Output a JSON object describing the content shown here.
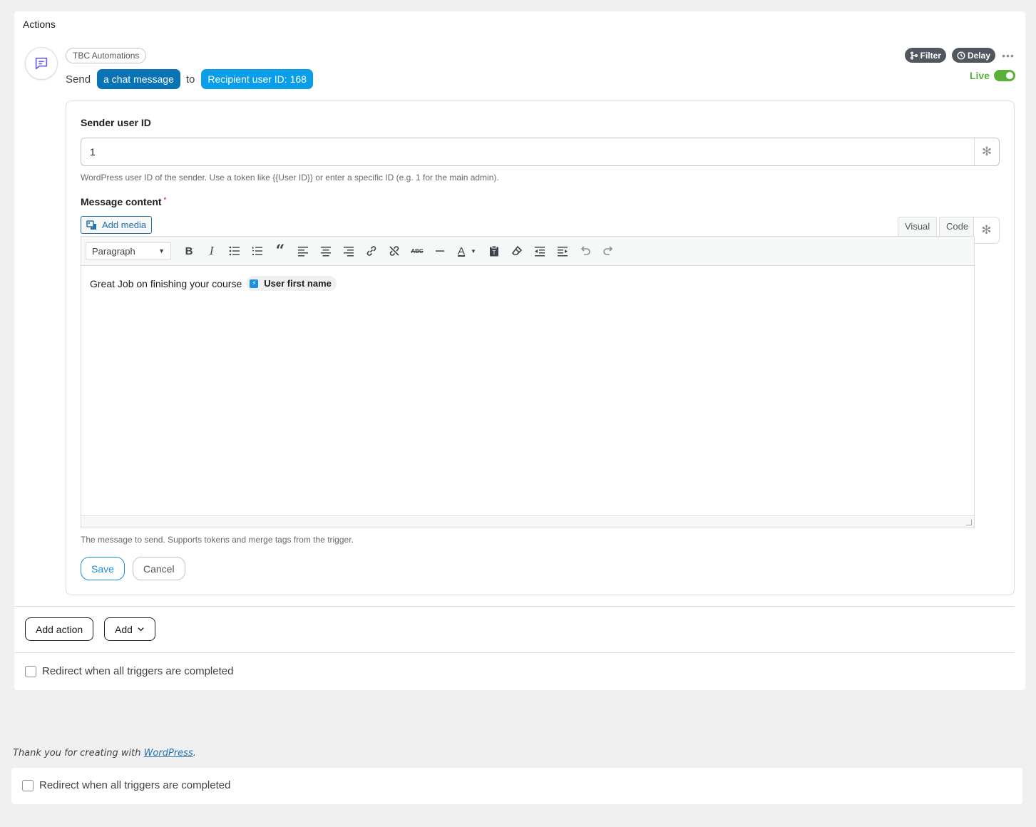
{
  "panel": {
    "title": "Actions"
  },
  "action": {
    "integration": "TBC Automations",
    "sentence_start": "Send",
    "sentence_option": "a chat message",
    "sentence_middle": "to",
    "sentence_target": "Recipient user ID: 168",
    "filter_label": "Filter",
    "delay_label": "Delay",
    "live_label": "Live",
    "live_on": true
  },
  "form": {
    "sender": {
      "label": "Sender user ID",
      "value": "1",
      "help": "WordPress user ID of the sender. Use a token like {{User ID}} or enter a specific ID (e.g. 1 for the main admin)."
    },
    "message": {
      "label": "Message content",
      "required_mark": "*",
      "add_media": "Add media",
      "tab_visual": "Visual",
      "tab_code": "Code",
      "format": "Paragraph",
      "content_text": "Great Job on finishing your course",
      "merge_tag": "User first name",
      "help": "The message to send. Supports tokens and merge tags from the trigger."
    },
    "save_label": "Save",
    "cancel_label": "Cancel"
  },
  "footer_actions": {
    "add_action": "Add action",
    "add": "Add"
  },
  "redirect_label": "Redirect when all triggers are completed",
  "thanks": {
    "prefix": "Thank you for creating with ",
    "link": "WordPress",
    "suffix": "."
  },
  "redirect_label_2": "Redirect when all triggers are completed",
  "colors": {
    "primary": "#0973b5",
    "accent": "#0b9ee8",
    "live": "#5bb138",
    "link": "#2271b1"
  }
}
